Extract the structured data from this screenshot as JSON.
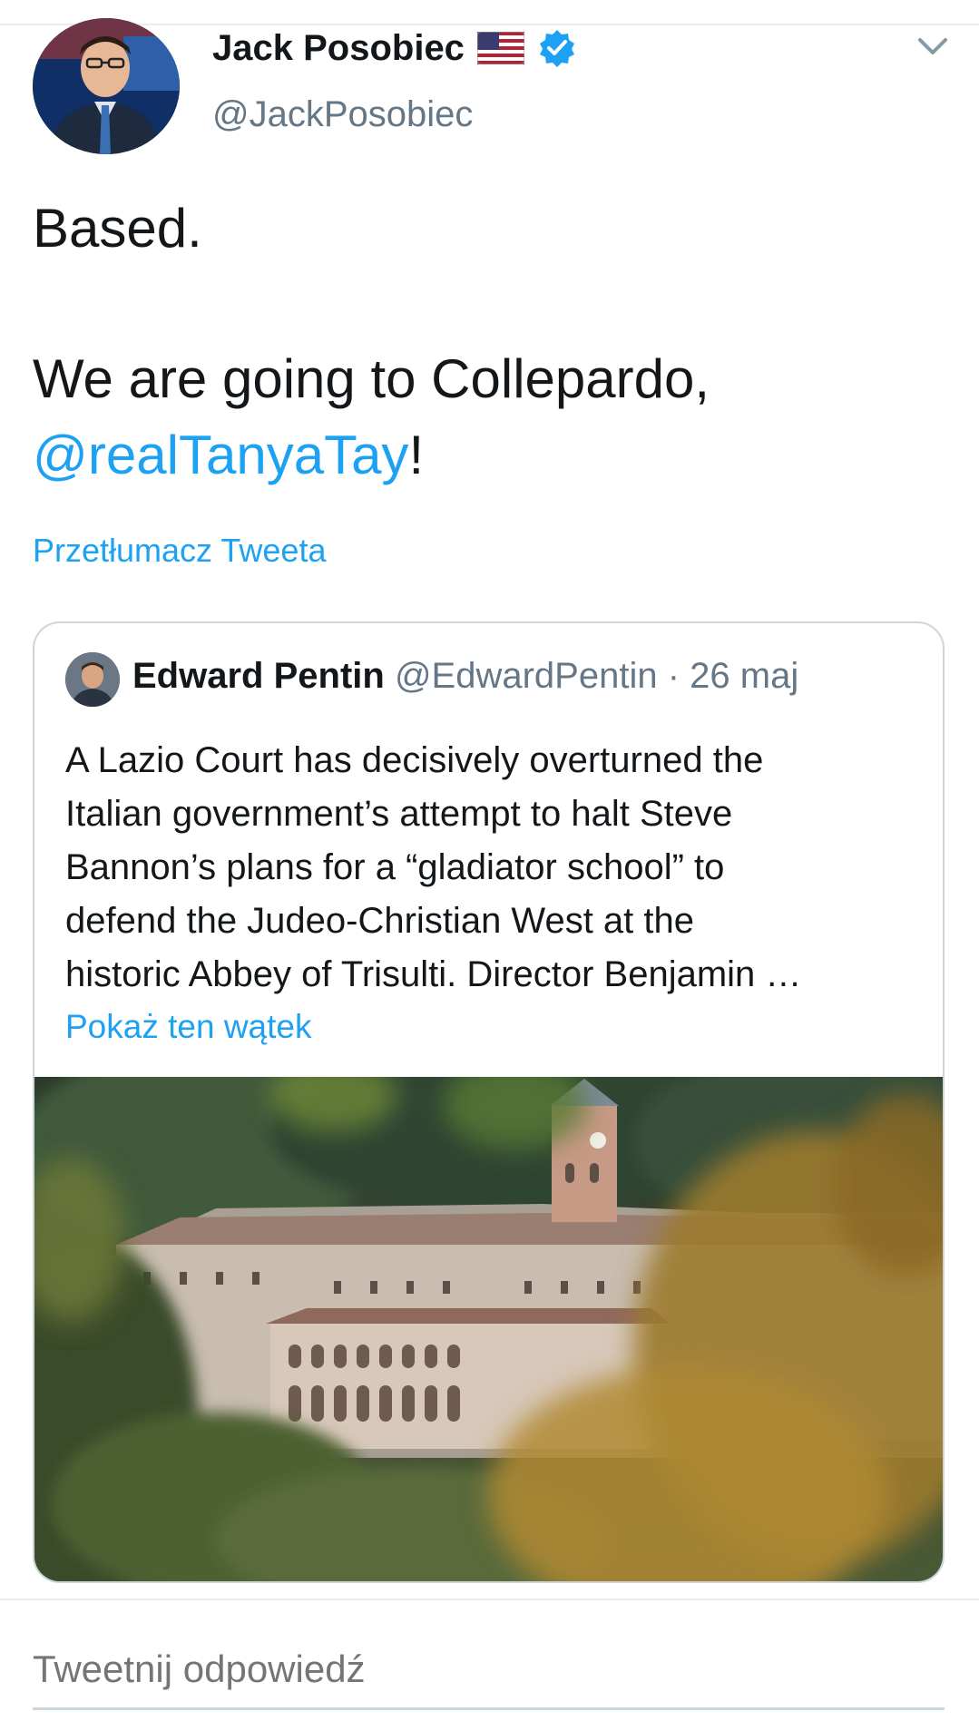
{
  "author": {
    "display_name": "Jack Posobiec",
    "handle": "@JackPosobiec",
    "avatar_icon": "profile-avatar",
    "flag_icon": "us-flag-icon",
    "verified_icon": "verified-badge-icon"
  },
  "tweet": {
    "line1": "Based.",
    "line2": "We are going to Collepardo,",
    "mention": "@realTanyaTay",
    "after_mention": "!",
    "translate_link": "Przetłumacz Tweeta"
  },
  "quoted": {
    "display_name": "Edward Pentin",
    "handle": "@EdwardPentin",
    "separator": " · ",
    "date": "26 maj",
    "text_lines": [
      "A Lazio Court has decisively overturned the",
      "Italian government’s attempt to halt Steve",
      "Bannon’s plans for a “gladiator school” to",
      "defend the Judeo-Christian West at the",
      "historic Abbey of Trisulti. Director Benjamin …"
    ],
    "thread_link": "Pokaż ten wątek",
    "image_icon": "abbey-photo"
  },
  "reply": {
    "placeholder": "Tweetnij odpowiedź"
  },
  "colors": {
    "link": "#1da1f2",
    "secondary": "#657786",
    "text": "#14171a",
    "border": "#ccd6dd"
  }
}
